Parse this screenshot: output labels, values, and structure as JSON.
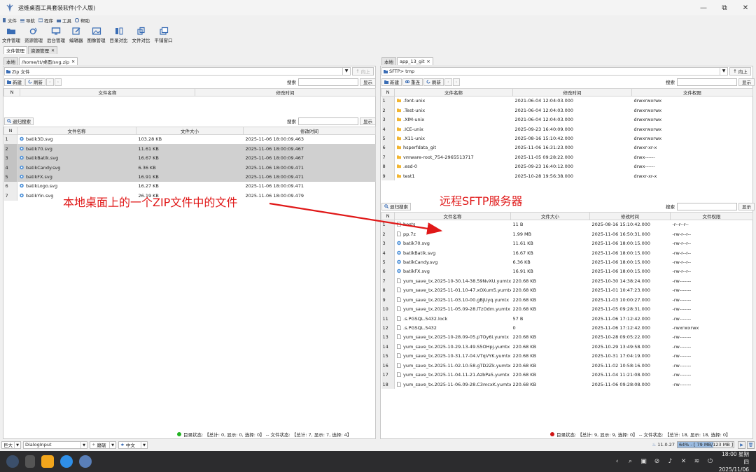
{
  "window": {
    "title": "运维桌面工具套装软件(个人版)",
    "controls": [
      "—",
      "⧉",
      "✕"
    ]
  },
  "menu": [
    "文件",
    "导航",
    "程序",
    "工具",
    "帮助"
  ],
  "toolbar": [
    "文件管理",
    "资源管理",
    "后台管理",
    "编辑器",
    "图像管理",
    "目录对比",
    "文件对比",
    "平铺窗口"
  ],
  "main_tabs": [
    "文件管理",
    "资源管理"
  ],
  "left": {
    "tabs": [
      "本地",
      "/home/tt/桌面/svg.zip"
    ],
    "path": "Zip 文件",
    "up_label": "向上",
    "actions": {
      "new": "新建",
      "refresh": "刷新"
    },
    "search_label": "搜索",
    "show_label": "显示",
    "upper_headers": [
      "N",
      "文件名称",
      "修改时间"
    ],
    "exit_search": "退归搜索",
    "lower_headers": [
      "N",
      "文件名称",
      "文件大小",
      "修改时间"
    ],
    "files": [
      {
        "n": "1",
        "name": "batik3D.svg",
        "size": "103.28 KB",
        "mtime": "2025-11-06 18:00:09.463",
        "sel": false
      },
      {
        "n": "2",
        "name": "batik70.svg",
        "size": "11.61 KB",
        "mtime": "2025-11-06 18:00:09.467",
        "sel": true
      },
      {
        "n": "3",
        "name": "batikBatik.svg",
        "size": "16.67 KB",
        "mtime": "2025-11-06 18:00:09.467",
        "sel": true
      },
      {
        "n": "4",
        "name": "batikCandy.svg",
        "size": "6.36 KB",
        "mtime": "2025-11-06 18:00:09.471",
        "sel": true
      },
      {
        "n": "5",
        "name": "batikFX.svg",
        "size": "16.91 KB",
        "mtime": "2025-11-06 18:00:09.471",
        "sel": true
      },
      {
        "n": "6",
        "name": "batikLogo.svg",
        "size": "16.27 KB",
        "mtime": "2025-11-06 18:00:09.471",
        "sel": false
      },
      {
        "n": "7",
        "name": "batikYin.svg",
        "size": "26.19 KB",
        "mtime": "2025-11-06 18:00:09.479",
        "sel": false
      }
    ],
    "status": "目录状态: 【总计: 0, 显示: 0, 选择: 0】 -- 文件状态: 【总计: 7, 显示: 7, 选择: 4】",
    "status_color": "#22b322"
  },
  "right": {
    "tabs": [
      "本地",
      "app_13_git"
    ],
    "path": "SFTP> tmp",
    "up_label": "向上",
    "actions": {
      "new": "新建",
      "reconnect": "重连",
      "refresh": "刷新"
    },
    "search_label": "搜索",
    "show_label": "显示",
    "dir_headers": [
      "N",
      "文件名称",
      "修改时间",
      "文件权限"
    ],
    "dirs": [
      {
        "n": "1",
        "name": ".font-unix",
        "mtime": "2021-06-04 12:04:03.000",
        "perm": "drwxrwxrwx"
      },
      {
        "n": "2",
        "name": ".Test-unix",
        "mtime": "2021-06-04 12:04:03.000",
        "perm": "drwxrwxrwx"
      },
      {
        "n": "3",
        "name": ".XIM-unix",
        "mtime": "2021-06-04 12:04:03.000",
        "perm": "drwxrwxrwx"
      },
      {
        "n": "4",
        "name": ".ICE-unix",
        "mtime": "2025-09-23 16:40:09.000",
        "perm": "drwxrwxrwx"
      },
      {
        "n": "5",
        "name": ".X11-unix",
        "mtime": "2025-08-16 15:10:42.000",
        "perm": "drwxrwxrwx"
      },
      {
        "n": "6",
        "name": "hsperfdata_git",
        "mtime": "2025-11-06 16:31:23.000",
        "perm": "drwxr-xr-x"
      },
      {
        "n": "7",
        "name": "vmware-root_754-2965513717",
        "mtime": "2025-11-05 09:28:22.000",
        "perm": "drwx------"
      },
      {
        "n": "8",
        "name": ".esd-0",
        "mtime": "2025-09-23 16:40:12.000",
        "perm": "drwx------"
      },
      {
        "n": "9",
        "name": "test1",
        "mtime": "2025-10-28 19:56:38.000",
        "perm": "drwxr-xr-x"
      }
    ],
    "exit_search": "退归搜索",
    "file_headers": [
      "N",
      "文件名称",
      "文件大小",
      "修改时间",
      "文件权限"
    ],
    "files": [
      {
        "n": "1",
        "name": "hosts",
        "type": "doc",
        "size": "11 B",
        "mtime": "2025-08-16 15:10:42.000",
        "perm": "-r--r--r--"
      },
      {
        "n": "2",
        "name": "pp.7z",
        "type": "doc",
        "size": "1.99 MB",
        "mtime": "2025-11-06 16:50:31.000",
        "perm": "-rw-r--r--"
      },
      {
        "n": "3",
        "name": "batik70.svg",
        "type": "svg",
        "size": "11.61 KB",
        "mtime": "2025-11-06 18:00:15.000",
        "perm": "-rw-r--r--"
      },
      {
        "n": "4",
        "name": "batikBatik.svg",
        "type": "svg",
        "size": "16.67 KB",
        "mtime": "2025-11-06 18:00:15.000",
        "perm": "-rw-r--r--"
      },
      {
        "n": "5",
        "name": "batikCandy.svg",
        "type": "svg",
        "size": "6.36 KB",
        "mtime": "2025-11-06 18:00:15.000",
        "perm": "-rw-r--r--"
      },
      {
        "n": "6",
        "name": "batikFX.svg",
        "type": "svg",
        "size": "16.91 KB",
        "mtime": "2025-11-06 18:00:15.000",
        "perm": "-rw-r--r--"
      },
      {
        "n": "7",
        "name": "yum_save_tx.2025-10-30.14-38.59NvXU.yumtx",
        "type": "doc",
        "size": "220.68 KB",
        "mtime": "2025-10-30 14:38:24.000",
        "perm": "-rw-------"
      },
      {
        "n": "8",
        "name": "yum_save_tx.2025-11-01.10-47.xOXum5.yumtx",
        "type": "doc",
        "size": "220.68 KB",
        "mtime": "2025-11-01 10:47:23.000",
        "perm": "-rw-------"
      },
      {
        "n": "9",
        "name": "yum_save_tx.2025-11-03.10-00.gBjUyq.yumtx",
        "type": "doc",
        "size": "220.68 KB",
        "mtime": "2025-11-03 10:00:27.000",
        "perm": "-rw-------"
      },
      {
        "n": "10",
        "name": "yum_save_tx.2025-11-05.09-28.lTzOdm.yumtx",
        "type": "doc",
        "size": "220.68 KB",
        "mtime": "2025-11-05 09:28:31.000",
        "perm": "-rw-------"
      },
      {
        "n": "11",
        "name": ".s.PGSQL.5432.lock",
        "type": "doc",
        "size": "57 B",
        "mtime": "2025-11-06 17:12:42.000",
        "perm": "-rw-------"
      },
      {
        "n": "12",
        "name": ".s.PGSQL.5432",
        "type": "doc",
        "size": "0",
        "mtime": "2025-11-06 17:12:42.000",
        "perm": "-rwxrwxrwx"
      },
      {
        "n": "13",
        "name": "yum_save_tx.2025-10-28.09-05.pTOy6i.yumtx",
        "type": "doc",
        "size": "220.68 KB",
        "mtime": "2025-10-28 09:05:22.000",
        "perm": "-rw-------"
      },
      {
        "n": "14",
        "name": "yum_save_tx.2025-10-29.13-49.S5OHpj.yumtx",
        "type": "doc",
        "size": "220.68 KB",
        "mtime": "2025-10-29 13:49:58.000",
        "perm": "-rw-------"
      },
      {
        "n": "15",
        "name": "yum_save_tx.2025-10-31.17-04.VTqVYK.yumtx",
        "type": "doc",
        "size": "220.68 KB",
        "mtime": "2025-10-31 17:04:19.000",
        "perm": "-rw-------"
      },
      {
        "n": "16",
        "name": "yum_save_tx.2025-11-02.10-58.gTD2Zk.yumtx",
        "type": "doc",
        "size": "220.68 KB",
        "mtime": "2025-11-02 10:58:16.000",
        "perm": "-rw-------"
      },
      {
        "n": "17",
        "name": "yum_save_tx.2025-11-04.11-21.AzbPa5.yumtx",
        "type": "doc",
        "size": "220.68 KB",
        "mtime": "2025-11-04 11:21:08.000",
        "perm": "-rw-------"
      },
      {
        "n": "18",
        "name": "yum_save_tx.2025-11-06.09-28.C3mcxK.yumtx",
        "type": "doc",
        "size": "220.68 KB",
        "mtime": "2025-11-06 09:28:08.000",
        "perm": "-rw-------"
      }
    ],
    "status": "目录状态: 【总计: 9, 显示: 9, 选择: 0】 -- 文件状态: 【总计: 18, 显示: 18, 选择: 0】",
    "status_color": "#d01515"
  },
  "bottom": {
    "zoom": "巨大",
    "input_font": "DialogInput",
    "theme": "磨砺",
    "lang": "中文",
    "version": "11.0.27",
    "memory": "64% - [ 79 MB/123 MB ]",
    "memory_fraction": 0.64
  },
  "annotations": {
    "left": "本地桌面上的一个ZIP文件中的文件",
    "right": "远程SFTP服务器",
    "color": "#e01818"
  },
  "taskbar": {
    "time": "18:00 星期四",
    "date": "2025/11/06"
  }
}
